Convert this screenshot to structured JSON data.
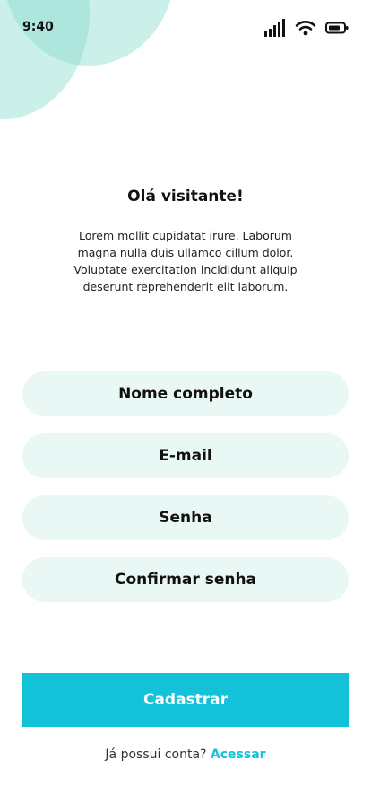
{
  "status_bar": {
    "time": "9:40",
    "icons": [
      "cellular-signal-icon",
      "wifi-icon",
      "battery-icon"
    ]
  },
  "header": {
    "greeting": "Olá visitante!",
    "intro": "Lorem mollit cupidatat irure. Laborum magna nulla duis ullamco cillum dolor. Voluptate exercitation incididunt aliquip deserunt reprehenderit elit laborum."
  },
  "form": {
    "full_name": {
      "placeholder": "Nome completo",
      "value": ""
    },
    "email": {
      "placeholder": "E-mail",
      "value": ""
    },
    "password": {
      "placeholder": "Senha",
      "value": ""
    },
    "confirm_password": {
      "placeholder": "Confirmar senha",
      "value": ""
    },
    "submit_label": "Cadastrar"
  },
  "footer": {
    "prompt": "Já possui conta?",
    "link_label": "Acessar"
  },
  "colors": {
    "accent": "#11C2D8",
    "field_bg": "#EAF8F5",
    "decor_circle": "#8CDBCE"
  }
}
